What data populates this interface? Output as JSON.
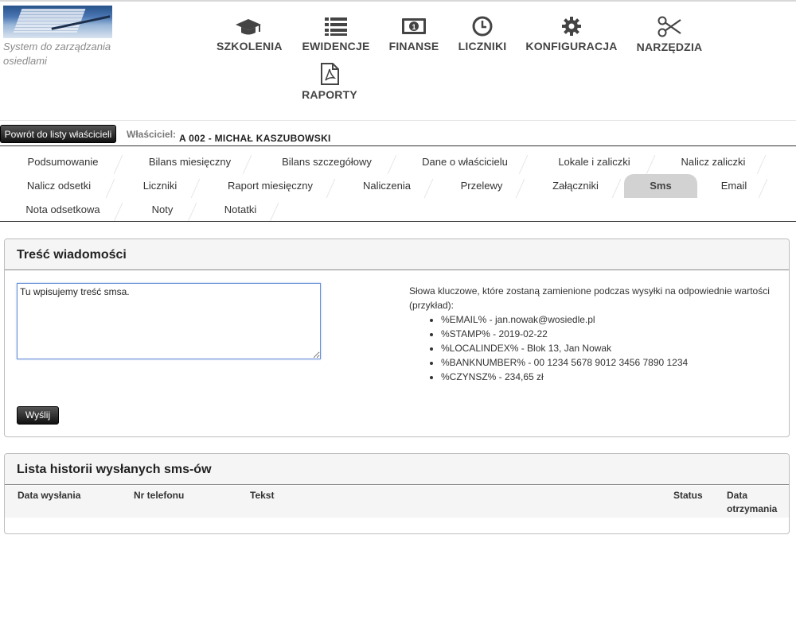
{
  "brand": {
    "tagline": "System do zarządzania osiedlami"
  },
  "nav": [
    {
      "label": "SZKOLENIA",
      "icon": "graduation-cap-icon"
    },
    {
      "label": "EWIDENCJE",
      "icon": "list-icon"
    },
    {
      "label": "FINANSE",
      "icon": "banknote-icon"
    },
    {
      "label": "LICZNIKI",
      "icon": "clock-icon"
    },
    {
      "label": "KONFIGURACJA",
      "icon": "gear-icon"
    },
    {
      "label": "NARZĘDZIA",
      "icon": "scissors-icon"
    },
    {
      "label": "RAPORTY",
      "icon": "pdf-file-icon"
    }
  ],
  "owner": {
    "back_label": "Powrót do listy właścicieli",
    "label": "Właściciel:",
    "value": "A 002 - MICHAŁ KASZUBOWSKI"
  },
  "tabs": [
    "Podsumowanie",
    "Bilans miesięczny",
    "Bilans szczegółowy",
    "Dane o właścicielu",
    "Lokale i zaliczki",
    "Nalicz zaliczki",
    "Nalicz odsetki",
    "Liczniki",
    "Raport miesięczny",
    "Naliczenia",
    "Przelewy",
    "Załączniki",
    "Sms",
    "Email",
    "Nota odsetkowa",
    "Noty",
    "Notatki"
  ],
  "active_tab": "Sms",
  "message": {
    "title": "Treść wiadomości",
    "text": "Tu wpisujemy treść smsa.",
    "send_label": "Wyślij",
    "keywords_intro": "Słowa kluczowe, które zostaną zamienione podczas wysyłki na odpowiednie wartości (przykład):",
    "keywords": [
      "%EMAIL% - jan.nowak@wosiedle.pl",
      "%STAMP% - 2019-02-22",
      "%LOCALINDEX% - Blok 13, Jan Nowak",
      "%BANKNUMBER% - 00 1234 5678 9012 3456 7890 1234",
      "%CZYNSZ% - 234,65 zł"
    ]
  },
  "history": {
    "title": "Lista historii wysłanych sms-ów",
    "columns": [
      "Data wysłania",
      "Nr telefonu",
      "Tekst",
      "Status",
      "Data otrzymania"
    ]
  }
}
